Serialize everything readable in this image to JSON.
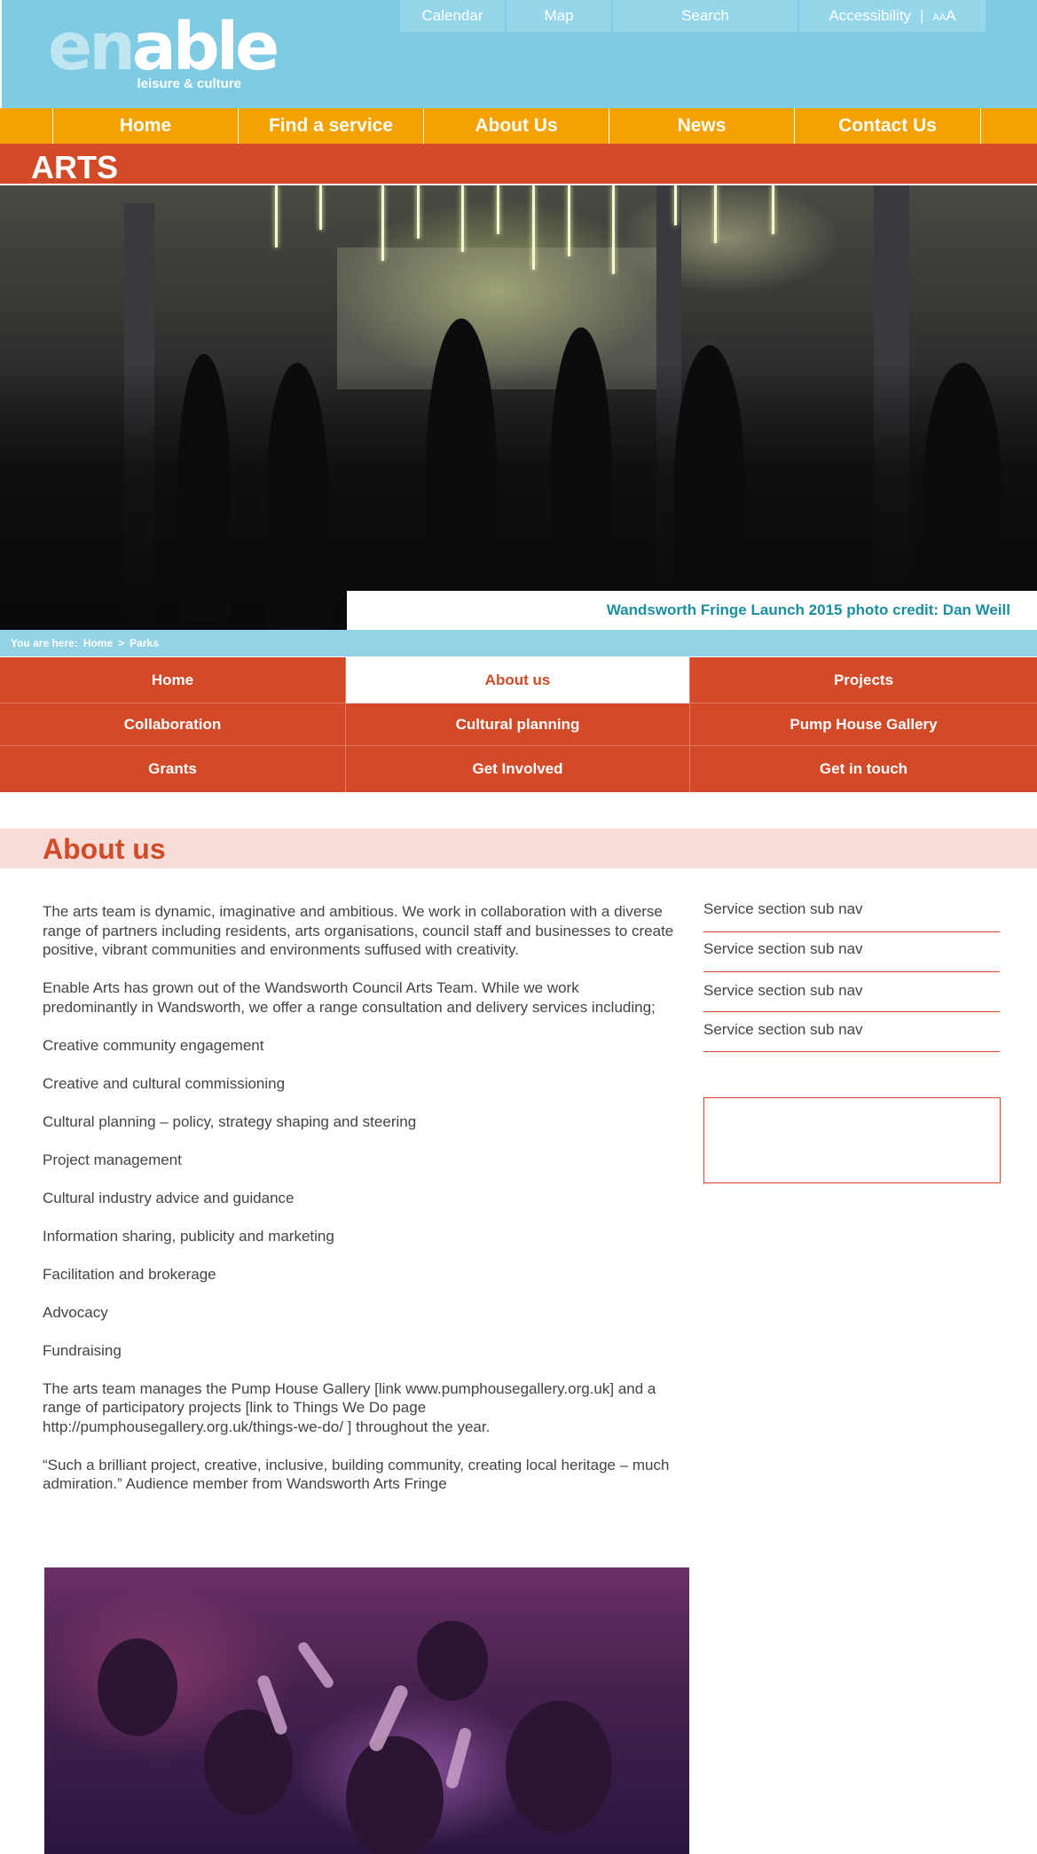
{
  "header": {
    "logo_text_en": "en",
    "logo_text_able": "able",
    "logo_sub": "leisure & culture",
    "utility": {
      "calendar": "Calendar",
      "map": "Map",
      "search": "Search",
      "accessibility": "Accessibility",
      "separator": "|",
      "text_size_small": "A",
      "text_size_med": "A",
      "text_size_large": "A"
    }
  },
  "main_nav": [
    "Home",
    "Find a service",
    "About Us",
    "News",
    "Contact Us"
  ],
  "section_title": "ARTS",
  "hero": {
    "caption": "Wandsworth Fringe Launch 2015 photo credit: Dan Weill"
  },
  "breadcrumb": {
    "prefix": "You are here:",
    "items": [
      "Home",
      "Parks"
    ],
    "separator": ">"
  },
  "sub_nav": [
    "Home",
    "About us",
    "Projects",
    "Collaboration",
    "Cultural planning",
    "Pump House Gallery",
    "Grants",
    "Get Involved",
    "Get in touch"
  ],
  "page_title": "About us",
  "content": {
    "paragraphs": [
      "The arts team is dynamic, imaginative and ambitious.  We work in collaboration with a diverse range of partners including residents, arts organisations, council staff and businesses to create positive, vibrant communities and environments suffused with creativity.",
      "Enable Arts has grown out of the Wandsworth Council Arts Team. While we work predominantly in Wandsworth, we offer a range consultation and delivery services including;",
      "Creative community engagement",
      "Creative and cultural commissioning",
      "Cultural planning – policy, strategy shaping and steering",
      "Project management",
      "Cultural industry advice and guidance",
      "Information sharing, publicity and marketing",
      "Facilitation and brokerage",
      "Advocacy",
      "Fundraising",
      "The arts team manages the Pump House Gallery [link www.pumphousegallery.org.uk] and a range of participatory projects [link to Things We Do page http://pumphousegallery.org.uk/things-we-do/ ] throughout the year.",
      "“Such a brilliant project, creative, inclusive, building community, creating local heritage – much admiration.” Audience member from Wandsworth Arts Fringe"
    ]
  },
  "side_nav": [
    "Service section sub nav",
    "Service section sub nav",
    "Service section sub nav",
    "Service section sub nav"
  ],
  "colors": {
    "header_blue": "#7ecbe3",
    "nav_orange": "#f4a201",
    "brand_red": "#d24a27",
    "title_band_pink": "#f7dcd7",
    "caption_teal": "#1b8ea0"
  }
}
